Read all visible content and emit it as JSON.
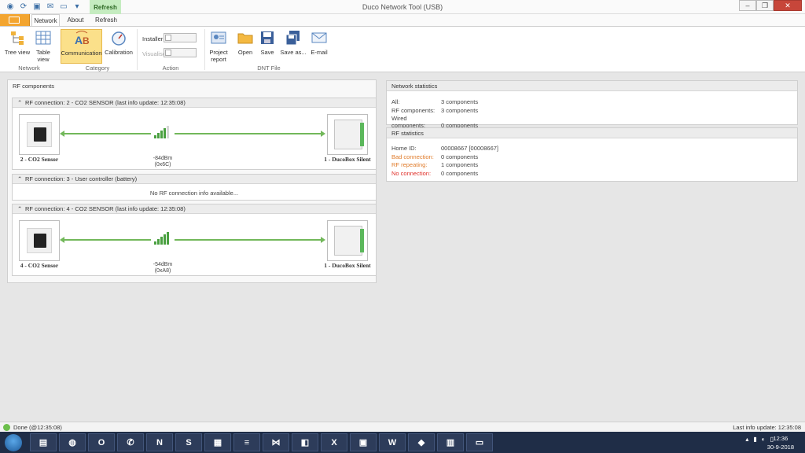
{
  "window": {
    "title": "Duco Network Tool (USB)",
    "context_tab": "Refresh"
  },
  "ribbon_tabs": [
    {
      "label": "Network"
    },
    {
      "label": "About"
    },
    {
      "label": "Refresh"
    }
  ],
  "ribbon": {
    "tree_view": "Tree view",
    "table_view": "Table view",
    "communication": "Communication",
    "calibration": "Calibration",
    "installer": "Installer",
    "visualise": "Visualise",
    "project_report": "Project report",
    "open": "Open",
    "save": "Save",
    "save_as": "Save as...",
    "email": "E-mail",
    "groups": {
      "network": "Network",
      "category": "Category",
      "action": "Action",
      "dnt_file": "DNT File"
    }
  },
  "rf_components": {
    "title": "RF components",
    "connections": [
      {
        "header": "RF connection: 2 - CO2 SENSOR (last info update: 12:35:08)",
        "left_device": "2 - CO2 Sensor",
        "right_device": "1 - DucoBox Silent",
        "signal_dbm": "-84dBm",
        "signal_hex": "(0x6C)",
        "signal_bars": 4
      },
      {
        "header": "RF connection: 3 - User controller (battery)",
        "message": "No RF connection info available..."
      },
      {
        "header": "RF connection: 4 - CO2 SENSOR (last info update: 12:35:08)",
        "left_device": "4 - CO2 Sensor",
        "right_device": "1 - DucoBox Silent",
        "signal_dbm": "-54dBm",
        "signal_hex": "(0xA8)",
        "signal_bars": 5
      }
    ]
  },
  "network_statistics": {
    "title": "Network statistics",
    "rows": [
      {
        "key": "All:",
        "value": "3 components"
      },
      {
        "key": "RF components:",
        "value": "3 components"
      },
      {
        "key": "Wired components:",
        "value": "0 components"
      }
    ]
  },
  "rf_statistics": {
    "title": "RF statistics",
    "rows": [
      {
        "key": "Home ID:",
        "value": "00008667 [00008667]"
      },
      {
        "key": "Bad connection:",
        "value": "0 components"
      },
      {
        "key": "RF repeating:",
        "value": "1 components"
      },
      {
        "key": "No connection:",
        "value": "0 components"
      }
    ]
  },
  "status": {
    "left": "Done (@12:35:08)",
    "right": "Last info update: 12:35:08"
  },
  "taskbar": {
    "time": "12:36",
    "date": "30-9-2018"
  },
  "colors": {
    "accent_green": "#72b85a",
    "orange": "#e07b2a",
    "red": "#e0302a",
    "file_tab": "#f3a530"
  }
}
